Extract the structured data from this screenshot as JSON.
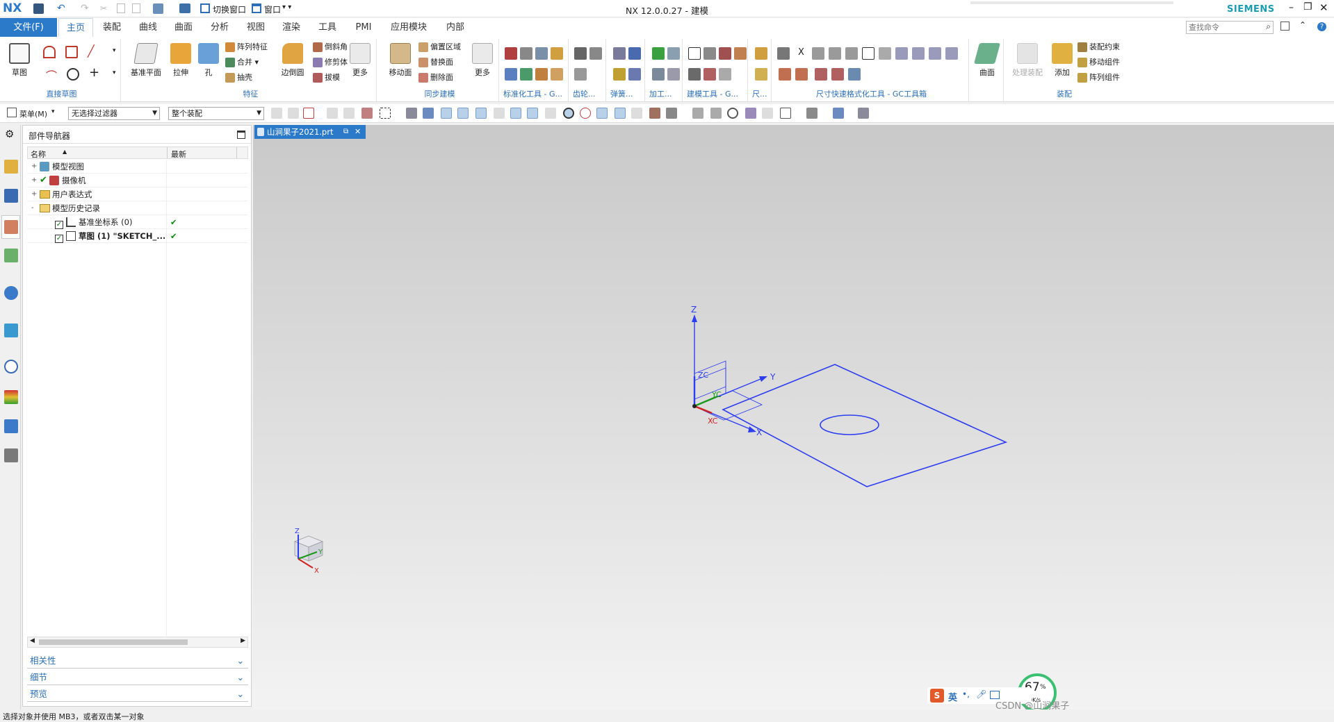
{
  "title_bar": {
    "app_logo": "NX",
    "title": "NX 12.0.0.27 - 建模",
    "brand": "SIEMENS",
    "switch_window": "切换窗口",
    "window_menu": "窗口"
  },
  "tabs": [
    "文件(F)",
    "主页",
    "装配",
    "曲线",
    "曲面",
    "分析",
    "视图",
    "渲染",
    "工具",
    "PMI",
    "应用模块",
    "内部"
  ],
  "search": {
    "placeholder": "查找命令"
  },
  "ribbon": {
    "sketch": {
      "label": "草图",
      "group": "直接草图"
    },
    "feature": {
      "datum_plane": "基准平面",
      "extrude": "拉伸",
      "hole": "孔",
      "pattern_feature": "阵列特征",
      "unite": "合并",
      "shell": "抽壳",
      "edge_blend": "边倒圆",
      "chamfer": "倒斜角",
      "trim_body": "修剪体",
      "draft": "拔模",
      "more": "更多",
      "group": "特征"
    },
    "sync": {
      "move_face": "移动面",
      "offset_region": "偏置区域",
      "replace_face": "替换面",
      "delete_face": "删除面",
      "more": "更多",
      "group": "同步建模"
    },
    "gc_groups": [
      "标准化工具 - G...",
      "齿轮...",
      "弹簧...",
      "加工...",
      "建模工具 - G...",
      "尺...",
      "尺寸快速格式化工具 - GC工具箱"
    ],
    "surface": {
      "label": "曲面"
    },
    "assembly": {
      "process_assembly": "处理装配",
      "add": "添加",
      "constraint": "装配约束",
      "move_component": "移动组件",
      "pattern_component": "阵列组件",
      "group": "装配"
    }
  },
  "cmdbar": {
    "menu": "菜单(M)",
    "filter": "无选择过滤器",
    "scope": "整个装配"
  },
  "doc_tab": "山涧果子2021.prt",
  "navigator": {
    "title": "部件导航器",
    "columns": [
      "名称",
      "最新"
    ],
    "items": [
      {
        "label": "模型视图",
        "level": 0,
        "expand": "+"
      },
      {
        "label": "摄像机",
        "level": 0,
        "expand": "+"
      },
      {
        "label": "用户表达式",
        "level": 0,
        "expand": "+"
      },
      {
        "label": "模型历史记录",
        "level": 0,
        "expand": "-"
      },
      {
        "label": "基准坐标系 (0)",
        "level": 1,
        "expand": "",
        "latest": "✔"
      },
      {
        "label": "草图 (1) \"SKETCH_...",
        "level": 1,
        "expand": "",
        "latest": "✔"
      }
    ],
    "panels": [
      "相关性",
      "细节",
      "预览"
    ]
  },
  "viewport": {
    "axis_labels": {
      "z": "Z",
      "zc": "ZC",
      "yc": "YC",
      "y": "Y",
      "xc": "XC",
      "x": "X"
    },
    "triad": {
      "z": "Z",
      "y": "Y",
      "x": "X"
    }
  },
  "statusbar": {
    "message": "选择对象并使用 MB3，或者双击某一对象",
    "watermark": "CSDN @山涧果子"
  },
  "perf": {
    "percent": "67",
    "unit": "%",
    "speed": "0K/s"
  },
  "ime": {
    "lang": "英"
  },
  "colors": {
    "accent": "#2b79c9",
    "sketch": "#2d3df0",
    "xc": "#d02020",
    "yc": "#1a9a1a"
  }
}
